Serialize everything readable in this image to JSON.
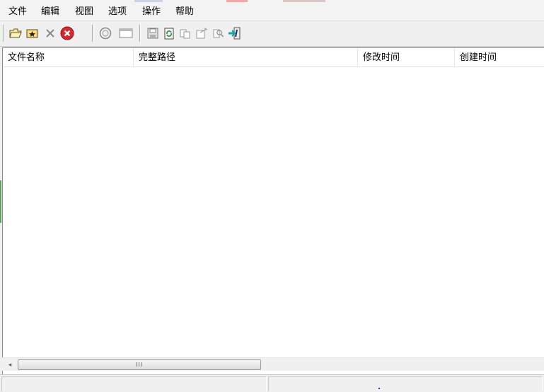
{
  "menu": {
    "items": [
      {
        "label": "文件"
      },
      {
        "label": "编辑"
      },
      {
        "label": "视图"
      },
      {
        "label": "选项"
      },
      {
        "label": "操作"
      },
      {
        "label": "帮助"
      }
    ]
  },
  "toolbar": {
    "buttons": [
      {
        "icon": "open-folder-icon"
      },
      {
        "icon": "star-folder-icon"
      },
      {
        "icon": "delete-x-icon"
      },
      {
        "icon": "stop-red-icon"
      },
      {
        "icon": "clock-icon"
      },
      {
        "icon": "window-icon"
      },
      {
        "icon": "save-icon"
      },
      {
        "icon": "refresh-icon"
      },
      {
        "icon": "copy-icon"
      },
      {
        "icon": "properties-icon"
      },
      {
        "icon": "find-icon"
      },
      {
        "icon": "exit-icon"
      }
    ]
  },
  "list": {
    "columns": [
      {
        "label": "文件名称"
      },
      {
        "label": "完整路径"
      },
      {
        "label": "修改时间"
      },
      {
        "label": "创建时间"
      }
    ],
    "rows": []
  },
  "scrollbar": {
    "left_arrow": "◂",
    "grip": "III"
  },
  "status": {
    "panes": [
      "",
      ""
    ]
  },
  "colors": {
    "menubar_bg": "#f3f3f3",
    "toolbar_bg": "#f0f0f0",
    "list_bg": "#ffffff",
    "stop_red": "#d9262c",
    "exit_teal": "#15a5a0"
  }
}
